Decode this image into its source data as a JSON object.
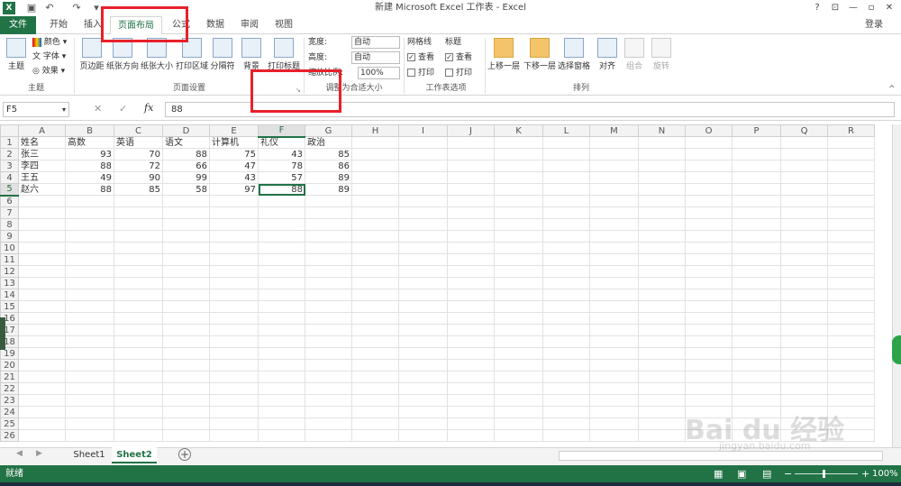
{
  "window": {
    "title": "新建 Microsoft Excel 工作表 - Excel",
    "help": "?",
    "minimize": "—",
    "restore": "▫",
    "close": "✕",
    "signin": "登录"
  },
  "tabs": [
    "文件",
    "开始",
    "插入",
    "页面布局",
    "公式",
    "数据",
    "审阅",
    "视图"
  ],
  "ribbon": {
    "theme": {
      "themes": "主题",
      "colors": "颜色",
      "fonts": "字体",
      "effects": "效果",
      "label": "主题"
    },
    "page_setup": {
      "margins": "页边距",
      "orientation": "纸张方向",
      "size": "纸张大小",
      "print_area": "打印区域",
      "breaks": "分隔符",
      "background": "背景",
      "print_titles": "打印标题",
      "label": "页面设置"
    },
    "scale": {
      "width_label": "宽度:",
      "width_value": "自动",
      "height_label": "高度:",
      "height_value": "自动",
      "scale_label": "缩放比例:",
      "scale_value": "100%",
      "label": "调整为合适大小"
    },
    "sheet_options": {
      "gridlines": "网格线",
      "headings": "标题",
      "view": "查看",
      "print": "打印",
      "label": "工作表选项"
    },
    "arrange": {
      "bring_forward": "上移一层",
      "send_backward": "下移一层",
      "selection_pane": "选择窗格",
      "align": "对齐",
      "group": "组合",
      "rotate": "旋转",
      "label": "排列"
    }
  },
  "formula_bar": {
    "name_box": "F5",
    "fx": "fx",
    "value": "88"
  },
  "columns": [
    "A",
    "B",
    "C",
    "D",
    "E",
    "F",
    "G",
    "H",
    "I",
    "J",
    "K",
    "L",
    "M",
    "N",
    "O",
    "P",
    "Q",
    "R"
  ],
  "table": {
    "headers": [
      "姓名",
      "高数",
      "英语",
      "语文",
      "计算机",
      "礼仪",
      "政治"
    ],
    "rows": [
      [
        "张三",
        "93",
        "70",
        "88",
        "75",
        "43",
        "85"
      ],
      [
        "李四",
        "88",
        "72",
        "66",
        "47",
        "78",
        "86"
      ],
      [
        "王五",
        "49",
        "90",
        "99",
        "43",
        "57",
        "89"
      ],
      [
        "赵六",
        "88",
        "85",
        "58",
        "97",
        "88",
        "89"
      ]
    ]
  },
  "sheets": [
    "Sheet1",
    "Sheet2"
  ],
  "status": {
    "ready": "就绪",
    "zoom": "100%"
  },
  "watermark": {
    "main": "Bai du 经验",
    "sub": "jingyan.baidu.com"
  }
}
